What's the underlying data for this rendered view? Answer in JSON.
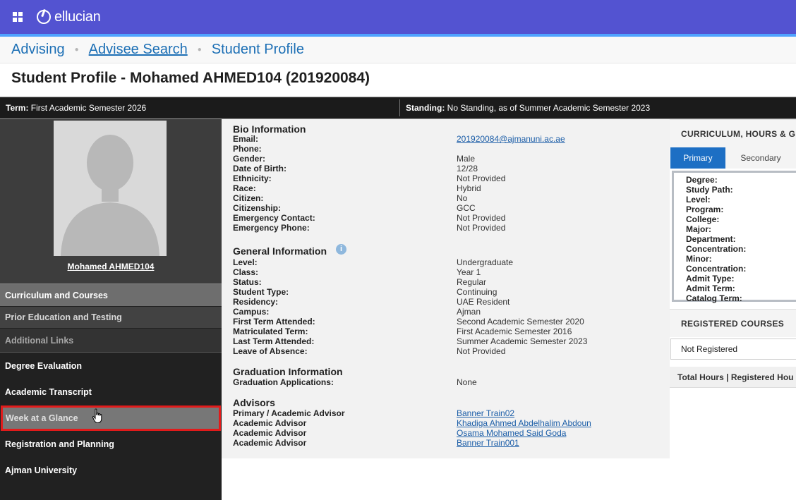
{
  "app": {
    "brand": "ellucian"
  },
  "breadcrumb": {
    "items": [
      {
        "label": "Advising"
      },
      {
        "label": "Advisee Search"
      },
      {
        "label": "Student Profile"
      }
    ]
  },
  "page_title": "Student Profile - Mohamed AHMED104 (201920084)",
  "termbar": {
    "term_label": "Term:",
    "term_value": "First Academic Semester 2026",
    "standing_label": "Standing:",
    "standing_value": "No Standing, as of Summer Academic Semester 2023"
  },
  "sidebar": {
    "student_name": "Mohamed AHMED104",
    "sections": [
      {
        "label": "Curriculum and Courses"
      },
      {
        "label": "Prior Education and Testing"
      },
      {
        "label": "Additional Links"
      }
    ],
    "links": [
      {
        "label": "Degree Evaluation"
      },
      {
        "label": "Academic Transcript"
      },
      {
        "label": "Week at a Glance"
      },
      {
        "label": "Registration and Planning"
      },
      {
        "label": "Ajman University"
      }
    ]
  },
  "bio": {
    "title": "Bio Information",
    "rows": [
      {
        "label": "Email:",
        "value": "201920084@ajmanuni.ac.ae"
      },
      {
        "label": "Phone:",
        "value": ""
      },
      {
        "label": "Gender:",
        "value": "Male"
      },
      {
        "label": "Date of Birth:",
        "value": "12/28"
      },
      {
        "label": "Ethnicity:",
        "value": "Not Provided"
      },
      {
        "label": "Race:",
        "value": "Hybrid"
      },
      {
        "label": "Citizen:",
        "value": "No"
      },
      {
        "label": "Citizenship:",
        "value": "GCC"
      },
      {
        "label": "Emergency Contact:",
        "value": "Not Provided"
      },
      {
        "label": "Emergency Phone:",
        "value": "Not Provided"
      }
    ]
  },
  "general": {
    "title": "General Information",
    "info_icon": "i",
    "rows": [
      {
        "label": "Level:",
        "value": "Undergraduate"
      },
      {
        "label": "Class:",
        "value": "Year 1"
      },
      {
        "label": "Status:",
        "value": "Regular"
      },
      {
        "label": "Student Type:",
        "value": "Continuing"
      },
      {
        "label": "Residency:",
        "value": "UAE Resident"
      },
      {
        "label": "Campus:",
        "value": "Ajman"
      },
      {
        "label": "First Term Attended:",
        "value": "Second Academic Semester 2020"
      },
      {
        "label": "Matriculated Term:",
        "value": "First Academic Semester 2016"
      },
      {
        "label": "Last Term Attended:",
        "value": "Summer Academic Semester 2023"
      },
      {
        "label": "Leave of Absence:",
        "value": "Not Provided"
      }
    ]
  },
  "graduation": {
    "title": "Graduation Information",
    "rows": [
      {
        "label": "Graduation Applications:",
        "value": "None"
      }
    ]
  },
  "advisors": {
    "title": "Advisors",
    "rows": [
      {
        "label": "Primary / Academic Advisor",
        "value": "Banner Train02"
      },
      {
        "label": "Academic Advisor",
        "value": "Khadiga Ahmed Abdelhalim Abdoun"
      },
      {
        "label": "Academic Advisor",
        "value": "Osama Mohamed Said Goda"
      },
      {
        "label": "Academic Advisor",
        "value": "Banner Train001"
      }
    ]
  },
  "curriculum_panel": {
    "title": "CURRICULUM, HOURS & GP",
    "tabs": [
      {
        "label": "Primary"
      },
      {
        "label": "Secondary"
      }
    ],
    "fields": [
      "Degree:",
      "Study Path:",
      "Level:",
      "Program:",
      "College:",
      "Major:",
      "Department:",
      "Concentration:",
      "Minor:",
      "Concentration:",
      "Admit Type:",
      "Admit Term:",
      "Catalog Term:"
    ]
  },
  "registered_panel": {
    "title": "REGISTERED COURSES",
    "status": "Not Registered",
    "total_hours_label": "Total Hours |",
    "registered_hours_label": "Registered Hou"
  },
  "colors": {
    "header_bg": "#5353d1",
    "link": "#1c6fb5",
    "highlight_border": "#e11b1b",
    "tab_active": "#1d6fc4"
  }
}
